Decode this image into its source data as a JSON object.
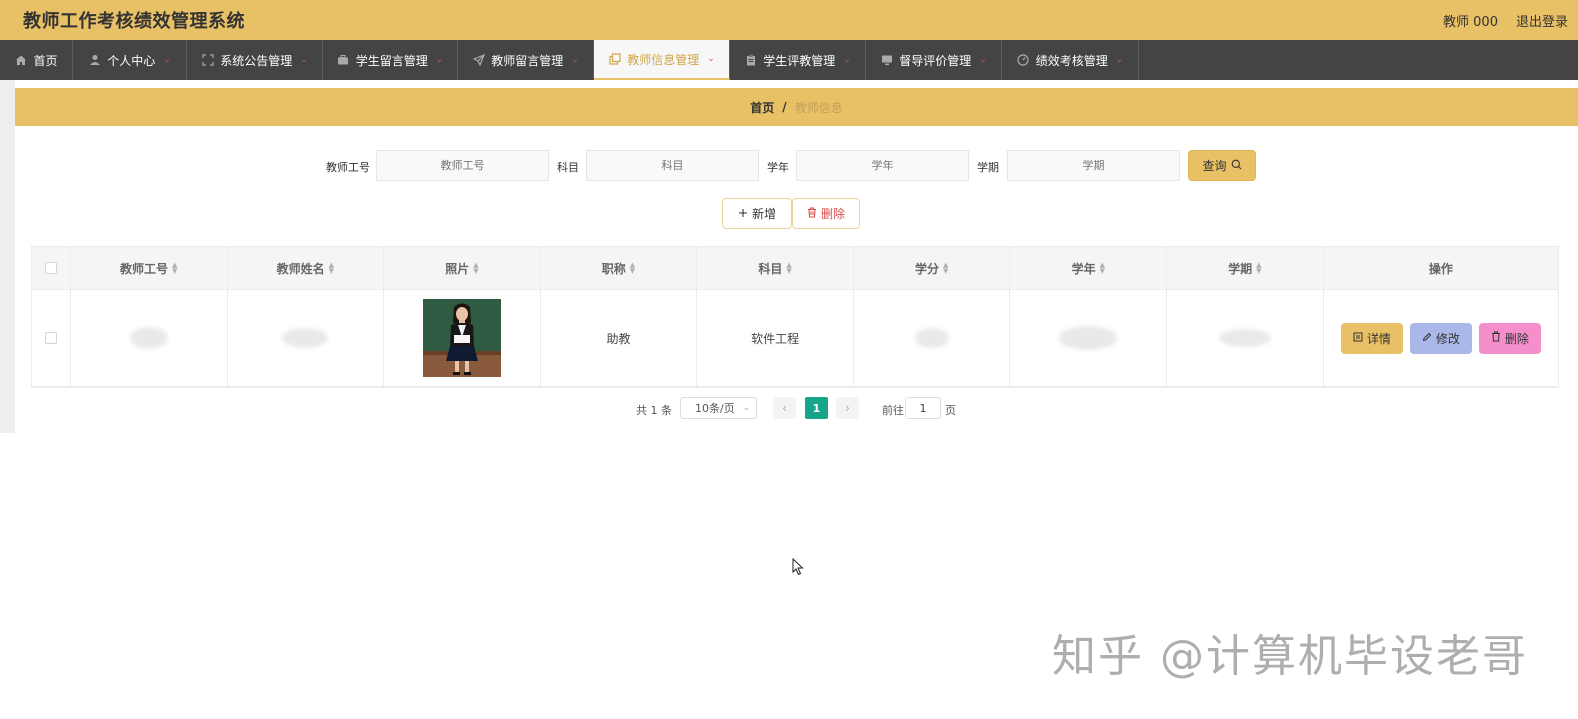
{
  "header": {
    "app_title": "教师工作考核绩效管理系统",
    "user_label": "教师 000",
    "logout_label": "退出登录"
  },
  "nav": {
    "items": [
      {
        "label": "首页",
        "icon": "home-icon",
        "has_caret": false
      },
      {
        "label": "个人中心",
        "icon": "user-icon",
        "has_caret": true
      },
      {
        "label": "系统公告管理",
        "icon": "expand-icon",
        "has_caret": true
      },
      {
        "label": "学生留言管理",
        "icon": "briefcase-icon",
        "has_caret": true
      },
      {
        "label": "教师留言管理",
        "icon": "send-icon",
        "has_caret": true
      },
      {
        "label": "教师信息管理",
        "icon": "copy-icon",
        "has_caret": true,
        "active": true
      },
      {
        "label": "学生评教管理",
        "icon": "clipboard-icon",
        "has_caret": true
      },
      {
        "label": "督导评价管理",
        "icon": "monitor-icon",
        "has_caret": true
      },
      {
        "label": "绩效考核管理",
        "icon": "gauge-icon",
        "has_caret": true
      }
    ]
  },
  "breadcrumb": {
    "home": "首页",
    "separator": "/",
    "current": "教师信息"
  },
  "search": {
    "teacher_id_label": "教师工号",
    "teacher_id_placeholder": "教师工号",
    "subject_label": "科目",
    "subject_placeholder": "科目",
    "year_label": "学年",
    "year_placeholder": "学年",
    "term_label": "学期",
    "term_placeholder": "学期",
    "query_label": "查询"
  },
  "actions": {
    "add_label": "新增",
    "delete_label": "删除"
  },
  "table": {
    "columns": [
      "教师工号",
      "教师姓名",
      "照片",
      "职称",
      "科目",
      "学分",
      "学年",
      "学期",
      "操作"
    ],
    "rows": [
      {
        "title": "助教",
        "subject": "软件工程"
      }
    ],
    "row_actions": {
      "detail": "详情",
      "edit": "修改",
      "delete": "删除"
    }
  },
  "pagination": {
    "total_text": "共 1 条",
    "page_size": "10条/页",
    "current_page": "1",
    "goto_label": "前往",
    "goto_value": "1",
    "page_suffix": "页"
  },
  "watermark": "知乎 @计算机毕设老哥",
  "colors": {
    "accent": "#e8c065",
    "nav_bg": "#444444",
    "pager_active": "#17a589",
    "edit_btn": "#a9b8e8",
    "delete_btn": "#f58fcb",
    "danger_text": "#e04b4b"
  }
}
